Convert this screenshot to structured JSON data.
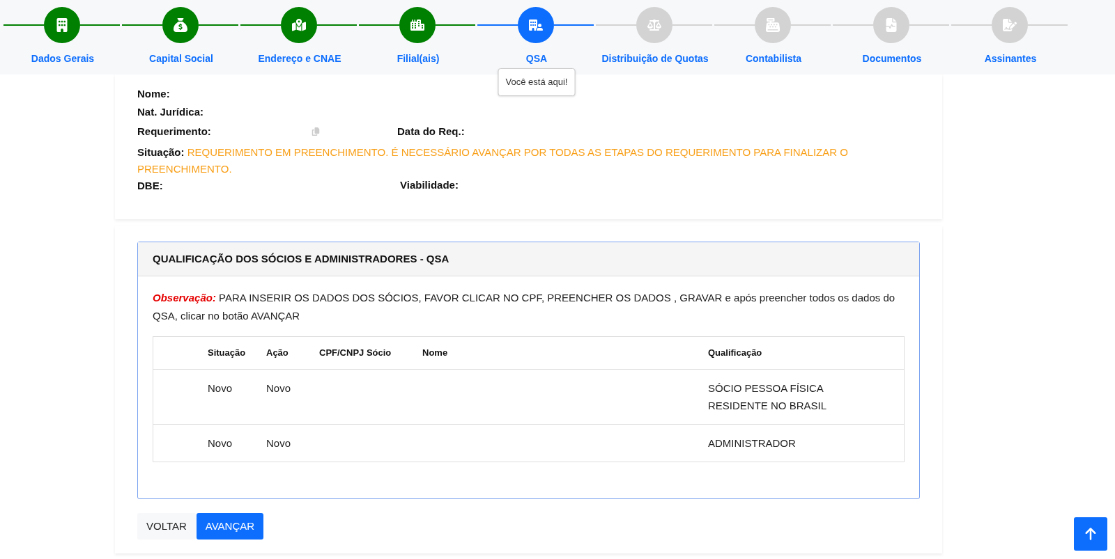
{
  "steps": [
    {
      "label": "Dados Gerais",
      "completed": true,
      "selected": false
    },
    {
      "label": "Capital Social",
      "completed": true,
      "selected": false
    },
    {
      "label": "Endereço e CNAE",
      "completed": true,
      "selected": false
    },
    {
      "label": "Filial(ais)",
      "completed": true,
      "selected": false
    },
    {
      "label": "QSA",
      "completed": false,
      "selected": true
    },
    {
      "label": "Distribuição de Quotas",
      "completed": false,
      "selected": false
    },
    {
      "label": "Contabilista",
      "completed": false,
      "selected": false
    },
    {
      "label": "Documentos",
      "completed": false,
      "selected": false
    },
    {
      "label": "Assinantes",
      "completed": false,
      "selected": false
    }
  ],
  "tooltip": "Você está aqui!",
  "info": {
    "nome": "Nome:",
    "nat": "Nat. Jurídica:",
    "requerimento": "Requerimento:",
    "data_req": "Data do Req.:",
    "situacao_label": "Situação:",
    "situacao_value": "REQUERIMENTO EM PREENCHIMENTO. É NECESSÁRIO AVANÇAR POR TODAS AS ETAPAS DO REQUERIMENTO PARA FINALIZAR O PREENCHIMENTO.",
    "dbe": "DBE:",
    "viabilidade": "Viabilidade:"
  },
  "panel": {
    "title": "QUALIFICAÇÃO DOS SÓCIOS E ADMINISTRADORES - QSA",
    "note": "**Observação:** PARA INSERIR OS DADOS DOS SÓCIOS, FAVOR CLICAR NO CPF, PREENCHER OS DADOS , GRAVAR e após preencher todos os dados do QSA, clicar no botão AVANÇAR",
    "table": {
      "columns": [
        "Situação",
        "Ação",
        "CPF/CNPJ Sócio",
        "Nome",
        "Qualificação"
      ],
      "rows": [
        {
          "situacao": "Novo",
          "acao": "Novo",
          "qualificacao": "SÓCIO PESSOA FÍSICA RESIDENTE NO BRASIL"
        },
        {
          "situacao": "Novo",
          "acao": "Novo",
          "qualificacao": "ADMINISTRADOR"
        }
      ]
    }
  },
  "buttons": {
    "back": "VOLTAR",
    "next": "AVANÇAR"
  }
}
